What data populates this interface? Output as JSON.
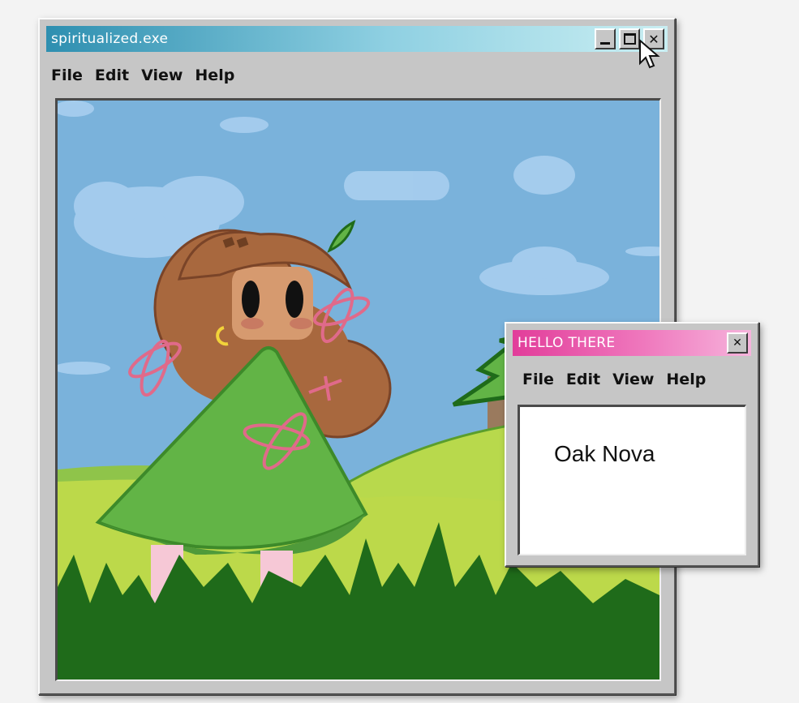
{
  "main_window": {
    "title": "spiritualized.exe",
    "menu": [
      "File",
      "Edit",
      "View",
      "Help"
    ],
    "colors": {
      "titlebar_start": "#2e8fb0",
      "titlebar_end": "#b8e6ec"
    },
    "buttons": [
      "minimize-icon",
      "maximize-icon",
      "close-icon"
    ]
  },
  "dialog": {
    "title": "HELLO THERE",
    "menu": [
      "File",
      "Edit",
      "View",
      "Help"
    ],
    "content_text": "Oak Nova",
    "colors": {
      "titlebar_start": "#e23d9a",
      "titlebar_end": "#f6b4dc"
    },
    "buttons": [
      "close-icon"
    ]
  },
  "artwork": {
    "subject": "illustration",
    "colors": {
      "sky": "#7ab2db",
      "grass": "#1f6b1a",
      "dress": "#62b446",
      "hair": "#a8683e"
    }
  }
}
